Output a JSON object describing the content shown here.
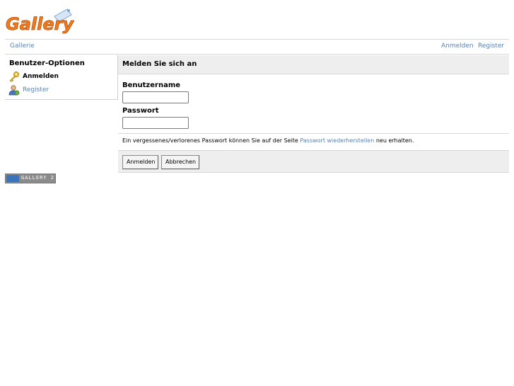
{
  "header": {
    "logo_text": "Gallery"
  },
  "breadcrumb": {
    "gallery": "Gallerie",
    "login": "Anmelden",
    "register": "Register"
  },
  "sidebar": {
    "title": "Benutzer-Optionen",
    "items": [
      {
        "label": "Anmelden",
        "icon": "key-icon"
      },
      {
        "label": "Register",
        "icon": "user-icon"
      }
    ]
  },
  "main": {
    "title": "Melden Sie sich an",
    "username_label": "Benutzername",
    "username_value": "",
    "password_label": "Passwort",
    "password_value": "",
    "recover_prefix": "Ein vergessenes/verlorenes Passwort können Sie auf der Seite",
    "recover_link": "Passwort wiederherstellen",
    "recover_suffix": "neu erhalten.",
    "buttons": {
      "login": "Anmelden",
      "cancel": "Abbrechen"
    }
  },
  "footer": {
    "badge_text": "GALLERY 2"
  },
  "colors": {
    "link": "#5a80b3",
    "logo_orange": "#f07a1c",
    "panel_bg": "#eeeeee"
  }
}
